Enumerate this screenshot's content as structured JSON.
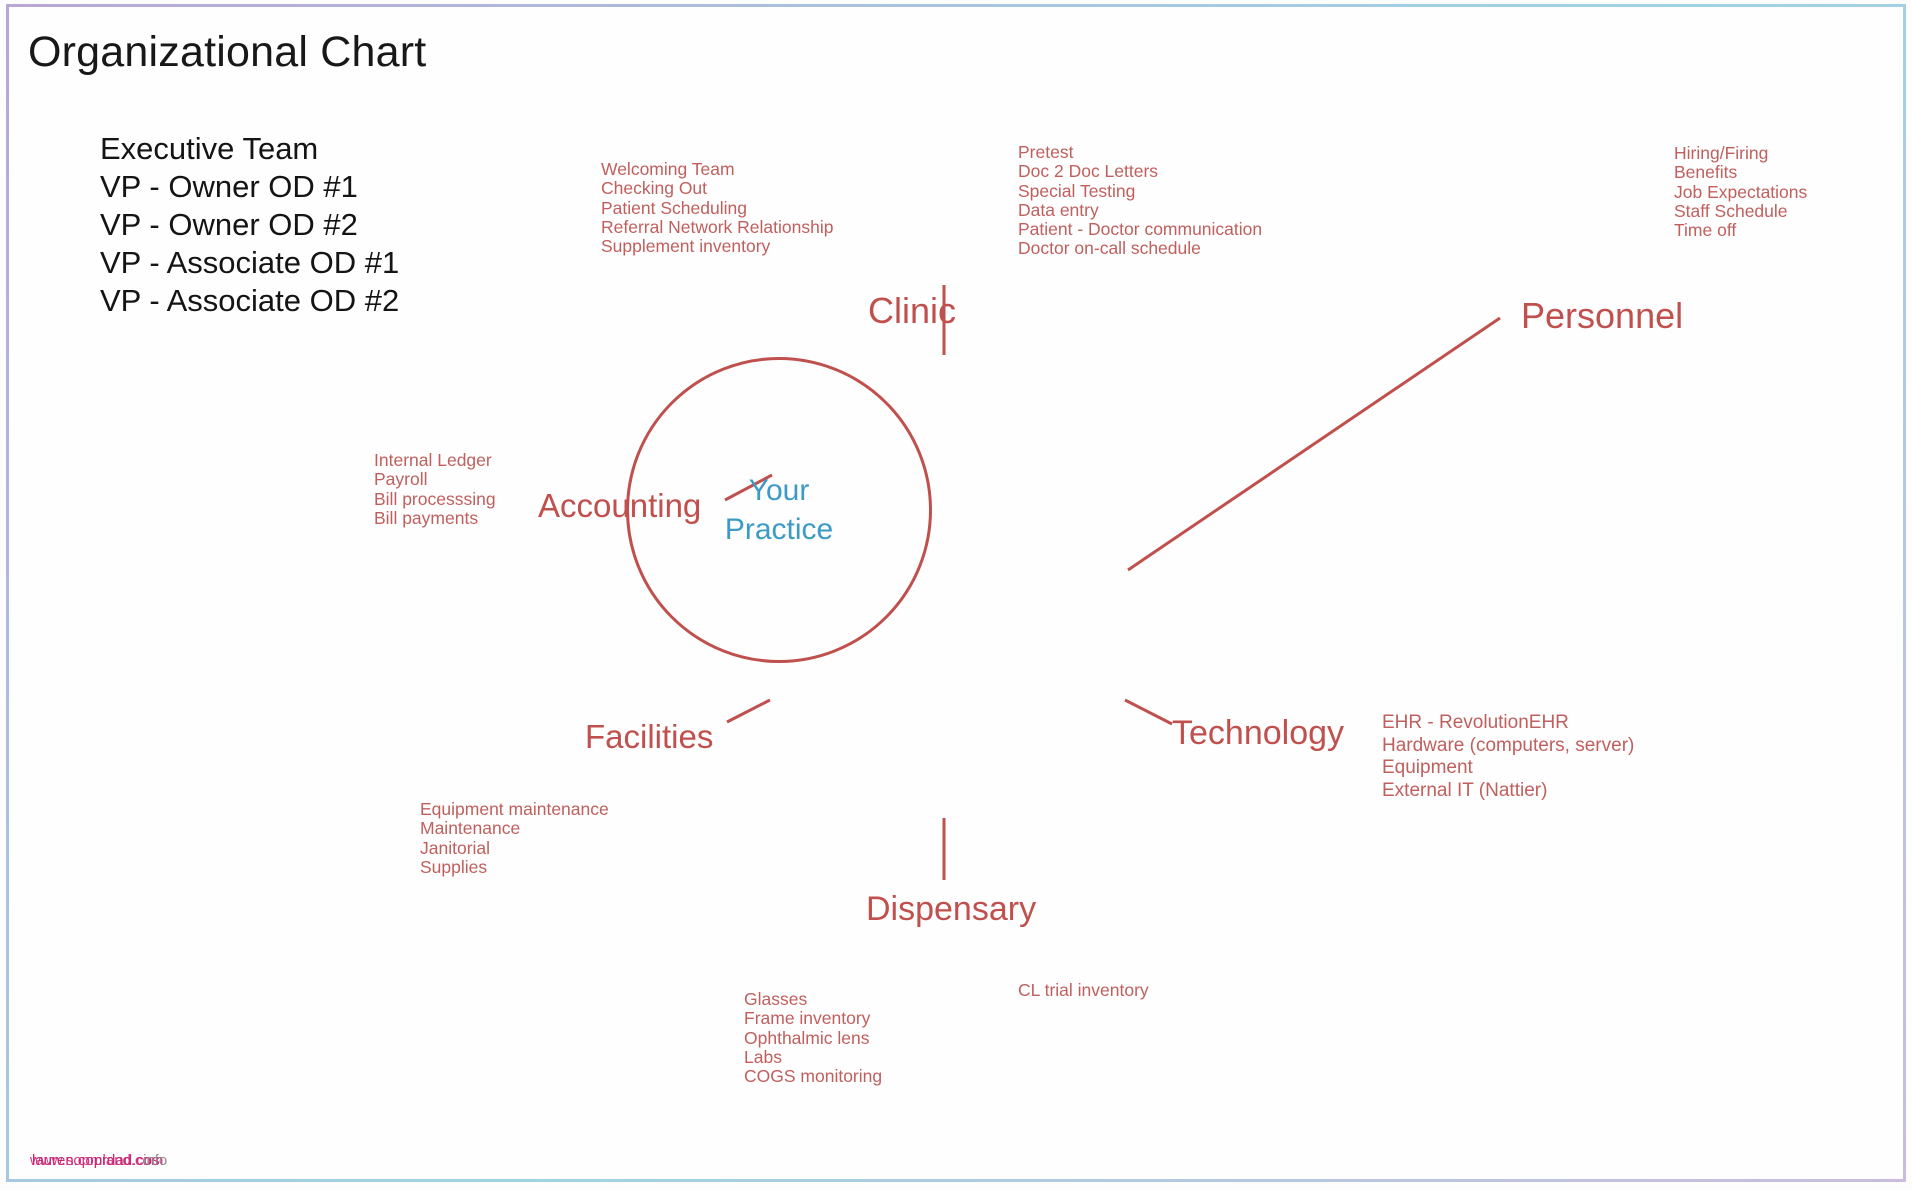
{
  "page": {
    "title": "Organizational Chart",
    "accent_red": "#c0504d",
    "detail_red": "#c0605e",
    "hub_blue": "#3c9bc4"
  },
  "executive": {
    "heading": "Executive Team",
    "members": [
      "VP - Owner OD #1",
      "VP - Owner OD #2",
      "VP - Associate OD #1",
      "VP - Associate OD #2"
    ]
  },
  "hub": {
    "line1": "Your",
    "line2": "Practice"
  },
  "branches": {
    "clinic": {
      "label": "Clinic",
      "items_left": [
        "Welcoming Team",
        "Checking Out",
        "Patient Scheduling",
        "Referral Network Relationship",
        "Supplement inventory"
      ],
      "items_right": [
        "Pretest",
        "Doc 2 Doc Letters",
        "Special Testing",
        "Data entry",
        "Patient - Doctor communication",
        "Doctor on-call schedule"
      ]
    },
    "personnel": {
      "label": "Personnel",
      "items": [
        "Hiring/Firing",
        "Benefits",
        "Job Expectations",
        "Staff Schedule",
        "Time off"
      ]
    },
    "accounting": {
      "label": "Accounting",
      "items": [
        "Internal Ledger",
        "Payroll",
        "Bill processsing",
        "Bill payments"
      ]
    },
    "technology": {
      "label": "Technology",
      "items": [
        "EHR - RevolutionEHR",
        "Hardware (computers, server)",
        "Equipment",
        "External IT (Nattier)"
      ]
    },
    "facilities": {
      "label": "Facilities",
      "items": [
        "Equipment maintenance",
        "Maintenance",
        "Janitorial",
        "Supplies"
      ]
    },
    "dispensary": {
      "label": "Dispensary",
      "items_left": [
        "Glasses",
        "Frame inventory",
        "Ophthalmic lens",
        "Labs",
        "COGS monitoring"
      ],
      "items_right": [
        "CL trial inventory"
      ]
    }
  },
  "footer": {
    "watermark_a": "www.sopmland.com",
    "watermark_b": "lauren.coprdad.cos",
    "watermark_c": "info"
  },
  "chart_data": {
    "type": "diagram",
    "title": "Organizational Chart",
    "center": "Your Practice",
    "nodes": [
      {
        "name": "Clinic",
        "angle_deg": 90,
        "children": [
          "Welcoming Team",
          "Checking Out",
          "Patient Scheduling",
          "Referral Network Relationship",
          "Supplement inventory",
          "Pretest",
          "Doc 2 Doc Letters",
          "Special Testing",
          "Data entry",
          "Patient - Doctor communication",
          "Doctor on-call schedule"
        ]
      },
      {
        "name": "Personnel",
        "angle_deg": 45,
        "children": [
          "Hiring/Firing",
          "Benefits",
          "Job Expectations",
          "Staff Schedule",
          "Time off"
        ]
      },
      {
        "name": "Technology",
        "angle_deg": 340,
        "children": [
          "EHR - RevolutionEHR",
          "Hardware (computers, server)",
          "Equipment",
          "External IT (Nattier)"
        ]
      },
      {
        "name": "Dispensary",
        "angle_deg": 270,
        "children": [
          "Glasses",
          "Frame inventory",
          "Ophthalmic lens",
          "Labs",
          "COGS monitoring",
          "CL trial inventory"
        ]
      },
      {
        "name": "Facilities",
        "angle_deg": 200,
        "children": [
          "Equipment maintenance",
          "Maintenance",
          "Janitorial",
          "Supplies"
        ]
      },
      {
        "name": "Accounting",
        "angle_deg": 155,
        "children": [
          "Internal Ledger",
          "Payroll",
          "Bill processsing",
          "Bill payments"
        ]
      }
    ]
  }
}
